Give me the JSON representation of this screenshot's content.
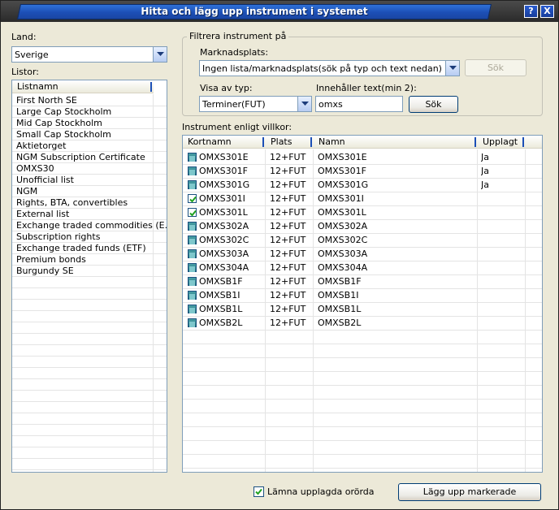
{
  "window": {
    "title": "Hitta och lägg upp instrument i systemet",
    "help_label": "?",
    "close_label": "X"
  },
  "left": {
    "land_label": "Land:",
    "land_value": "Sverige",
    "lists_label": "Listor:",
    "list_header": "Listnamn",
    "lists": [
      "First North SE",
      "Large Cap Stockholm",
      "Mid Cap Stockholm",
      "Small Cap Stockholm",
      "Aktietorget",
      "NGM Subscription Certificate",
      "OMXS30",
      "Unofficial list",
      "NGM",
      "Rights, BTA, convertibles",
      "External list",
      "Exchange traded commodities (E...",
      "Subscription rights",
      "Exchange traded funds (ETF)",
      "Premium bonds",
      "Burgundy SE"
    ]
  },
  "filter": {
    "group_label": "Filtrera instrument på",
    "market_label": "Marknadsplats:",
    "market_value": "Ingen lista/marknadsplats(sök på typ och text nedan)",
    "search_disabled_label": "Sök",
    "type_label": "Visa av typ:",
    "type_value": "Terminer(FUT)",
    "text_label": "Innehåller text(min 2):",
    "text_value": "omxs",
    "search_label": "Sök"
  },
  "instruments": {
    "label": "Instrument enligt villkor:",
    "columns": [
      "Kortnamn",
      "Plats",
      "Namn",
      "Upplagt"
    ],
    "rows": [
      {
        "kortnamn": "OMXS301E",
        "plats": "12+FUT",
        "namn": "OMXS301E",
        "upplagt": "Ja",
        "checked": false
      },
      {
        "kortnamn": "OMXS301F",
        "plats": "12+FUT",
        "namn": "OMXS301F",
        "upplagt": "Ja",
        "checked": false
      },
      {
        "kortnamn": "OMXS301G",
        "plats": "12+FUT",
        "namn": "OMXS301G",
        "upplagt": "Ja",
        "checked": false
      },
      {
        "kortnamn": "OMXS301I",
        "plats": "12+FUT",
        "namn": "OMXS301I",
        "upplagt": "",
        "checked": true
      },
      {
        "kortnamn": "OMXS301L",
        "plats": "12+FUT",
        "namn": "OMXS301L",
        "upplagt": "",
        "checked": true
      },
      {
        "kortnamn": "OMXS302A",
        "plats": "12+FUT",
        "namn": "OMXS302A",
        "upplagt": "",
        "checked": false
      },
      {
        "kortnamn": "OMXS302C",
        "plats": "12+FUT",
        "namn": "OMXS302C",
        "upplagt": "",
        "checked": false
      },
      {
        "kortnamn": "OMXS303A",
        "plats": "12+FUT",
        "namn": "OMXS303A",
        "upplagt": "",
        "checked": false
      },
      {
        "kortnamn": "OMXS304A",
        "plats": "12+FUT",
        "namn": "OMXS304A",
        "upplagt": "",
        "checked": false
      },
      {
        "kortnamn": "OMXSB1F",
        "plats": "12+FUT",
        "namn": "OMXSB1F",
        "upplagt": "",
        "checked": false
      },
      {
        "kortnamn": "OMXSB1I",
        "plats": "12+FUT",
        "namn": "OMXSB1I",
        "upplagt": "",
        "checked": false
      },
      {
        "kortnamn": "OMXSB1L",
        "plats": "12+FUT",
        "namn": "OMXSB1L",
        "upplagt": "",
        "checked": false
      },
      {
        "kortnamn": "OMXSB2L",
        "plats": "12+FUT",
        "namn": "OMXSB2L",
        "upplagt": "",
        "checked": false
      }
    ]
  },
  "footer": {
    "keep_orders_label": "Lämna upplagda orörda",
    "keep_orders_checked": true,
    "submit_label": "Lägg upp markerade"
  },
  "colors": {
    "title_blue": "#1c4fb6",
    "window_bg": "#ece9d8",
    "unchecked_teal": "#2a7f88"
  }
}
